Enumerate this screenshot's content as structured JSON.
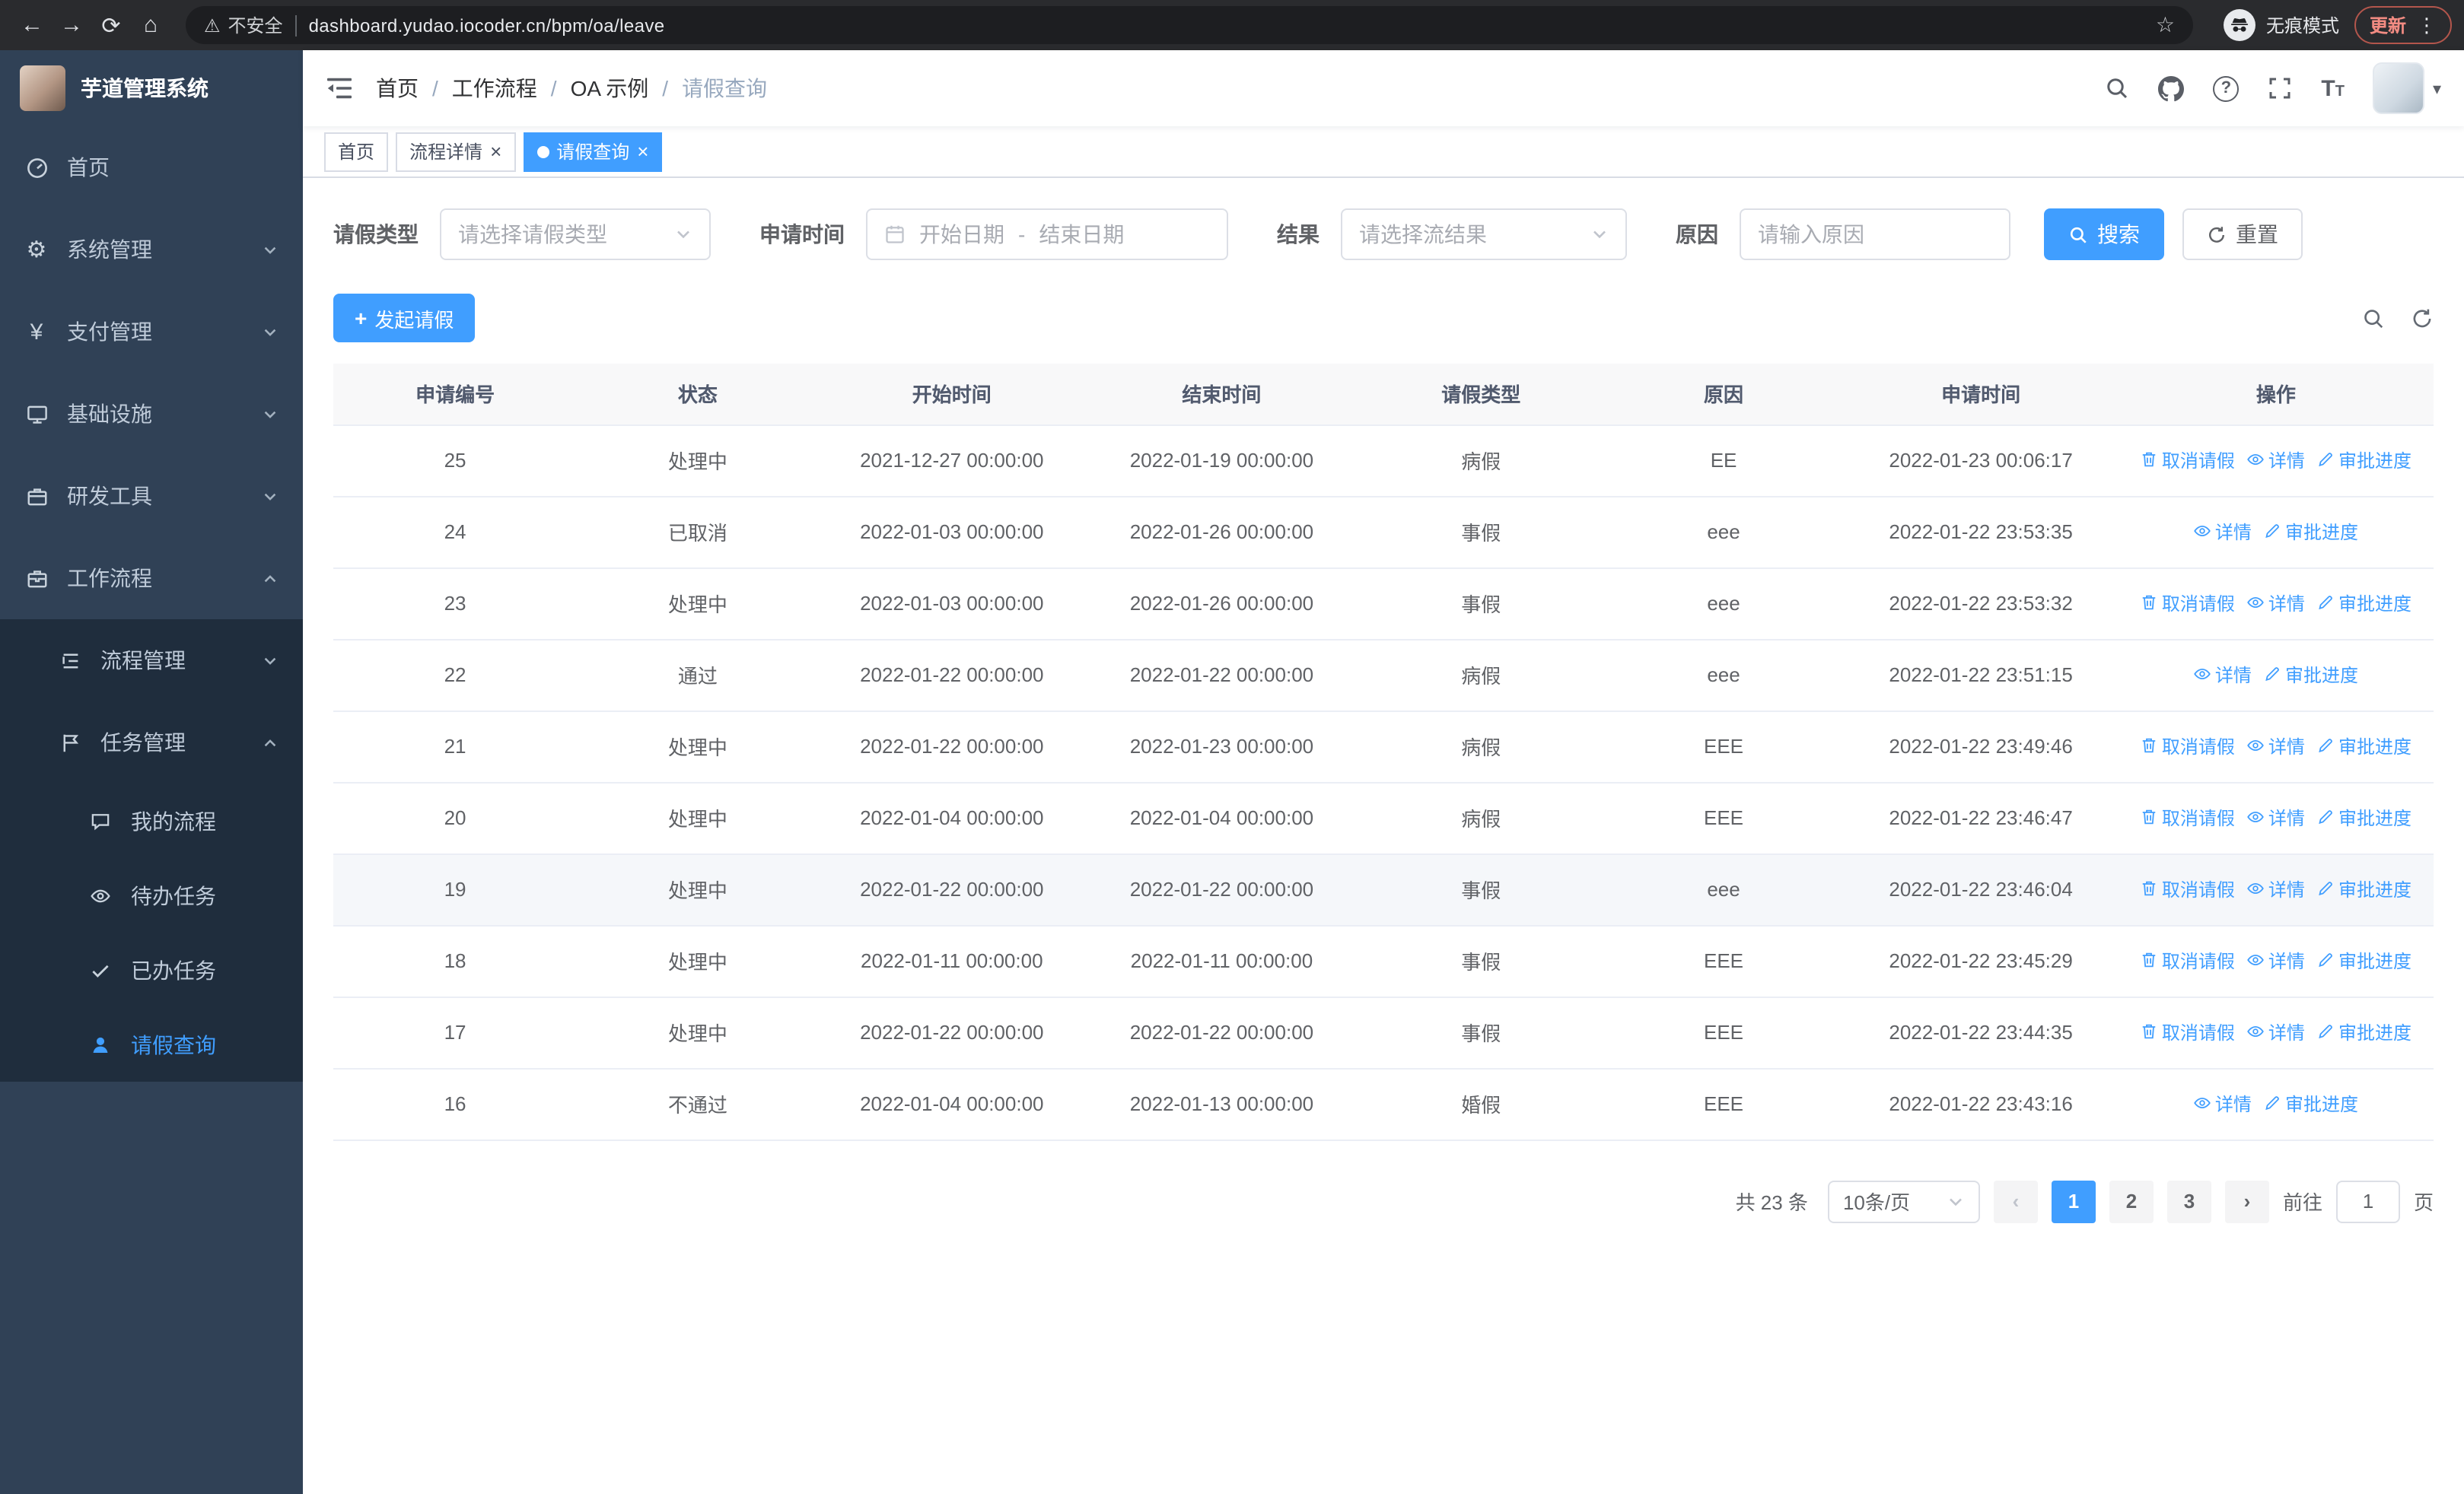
{
  "browser": {
    "security_chip": "不安全",
    "url": "dashboard.yudao.iocoder.cn/bpm/oa/leave",
    "incognito_label": "无痕模式",
    "update_label": "更新"
  },
  "icons": {
    "back": "←",
    "forward": "→",
    "reload": "⟳",
    "home": "⌂",
    "warning": "⚠",
    "star": "☆",
    "menu_dots": "⋮",
    "gear": "⚙",
    "yen": "¥",
    "caret_down": "▾",
    "close": "×",
    "plus": "+",
    "prev": "‹",
    "next": "›",
    "question": "?"
  },
  "sidebar": {
    "app_title": "芋道管理系统",
    "items": [
      {
        "label": "首页"
      },
      {
        "label": "系统管理"
      },
      {
        "label": "支付管理"
      },
      {
        "label": "基础设施"
      },
      {
        "label": "研发工具"
      },
      {
        "label": "工作流程"
      }
    ],
    "submenu": [
      {
        "label": "流程管理"
      },
      {
        "label": "任务管理"
      }
    ],
    "task_children": [
      {
        "label": "我的流程"
      },
      {
        "label": "待办任务"
      },
      {
        "label": "已办任务"
      },
      {
        "label": "请假查询"
      }
    ]
  },
  "header": {
    "breadcrumb": [
      "首页",
      "工作流程",
      "OA 示例",
      "请假查询"
    ]
  },
  "tabs": [
    {
      "label": "首页"
    },
    {
      "label": "流程详情"
    },
    {
      "label": "请假查询"
    }
  ],
  "filters": {
    "leave_type_label": "请假类型",
    "leave_type_placeholder": "请选择请假类型",
    "apply_time_label": "申请时间",
    "start_date_placeholder": "开始日期",
    "date_separator": "-",
    "end_date_placeholder": "结束日期",
    "result_label": "结果",
    "result_placeholder": "请选择流结果",
    "reason_label": "原因",
    "reason_placeholder": "请输入原因",
    "search_label": "搜索",
    "reset_label": "重置"
  },
  "toolbar": {
    "create_label": "发起请假"
  },
  "table": {
    "columns": [
      "申请编号",
      "状态",
      "开始时间",
      "结束时间",
      "请假类型",
      "原因",
      "申请时间",
      "操作"
    ],
    "action_labels": {
      "cancel": "取消请假",
      "detail": "详情",
      "progress": "审批进度"
    },
    "rows": [
      {
        "id": "25",
        "status": "处理中",
        "start": "2021-12-27 00:00:00",
        "end": "2022-01-19 00:00:00",
        "type": "病假",
        "reason": "EE",
        "applied": "2022-01-23 00:06:17",
        "actions": [
          "cancel",
          "detail",
          "progress"
        ]
      },
      {
        "id": "24",
        "status": "已取消",
        "start": "2022-01-03 00:00:00",
        "end": "2022-01-26 00:00:00",
        "type": "事假",
        "reason": "eee",
        "applied": "2022-01-22 23:53:35",
        "actions": [
          "detail",
          "progress"
        ]
      },
      {
        "id": "23",
        "status": "处理中",
        "start": "2022-01-03 00:00:00",
        "end": "2022-01-26 00:00:00",
        "type": "事假",
        "reason": "eee",
        "applied": "2022-01-22 23:53:32",
        "actions": [
          "cancel",
          "detail",
          "progress"
        ]
      },
      {
        "id": "22",
        "status": "通过",
        "start": "2022-01-22 00:00:00",
        "end": "2022-01-22 00:00:00",
        "type": "病假",
        "reason": "eee",
        "applied": "2022-01-22 23:51:15",
        "actions": [
          "detail",
          "progress"
        ]
      },
      {
        "id": "21",
        "status": "处理中",
        "start": "2022-01-22 00:00:00",
        "end": "2022-01-23 00:00:00",
        "type": "病假",
        "reason": "EEE",
        "applied": "2022-01-22 23:49:46",
        "actions": [
          "cancel",
          "detail",
          "progress"
        ]
      },
      {
        "id": "20",
        "status": "处理中",
        "start": "2022-01-04 00:00:00",
        "end": "2022-01-04 00:00:00",
        "type": "病假",
        "reason": "EEE",
        "applied": "2022-01-22 23:46:47",
        "actions": [
          "cancel",
          "detail",
          "progress"
        ]
      },
      {
        "id": "19",
        "status": "处理中",
        "start": "2022-01-22 00:00:00",
        "end": "2022-01-22 00:00:00",
        "type": "事假",
        "reason": "eee",
        "applied": "2022-01-22 23:46:04",
        "actions": [
          "cancel",
          "detail",
          "progress"
        ],
        "highlighted": true
      },
      {
        "id": "18",
        "status": "处理中",
        "start": "2022-01-11 00:00:00",
        "end": "2022-01-11 00:00:00",
        "type": "事假",
        "reason": "EEE",
        "applied": "2022-01-22 23:45:29",
        "actions": [
          "cancel",
          "detail",
          "progress"
        ]
      },
      {
        "id": "17",
        "status": "处理中",
        "start": "2022-01-22 00:00:00",
        "end": "2022-01-22 00:00:00",
        "type": "事假",
        "reason": "EEE",
        "applied": "2022-01-22 23:44:35",
        "actions": [
          "cancel",
          "detail",
          "progress"
        ]
      },
      {
        "id": "16",
        "status": "不通过",
        "start": "2022-01-04 00:00:00",
        "end": "2022-01-13 00:00:00",
        "type": "婚假",
        "reason": "EEE",
        "applied": "2022-01-22 23:43:16",
        "actions": [
          "detail",
          "progress"
        ]
      }
    ]
  },
  "pagination": {
    "total": "共 23 条",
    "page_size": "10条/页",
    "pages": [
      "1",
      "2",
      "3"
    ],
    "active_page": "1",
    "goto_label": "前往",
    "goto_value": "1",
    "page_suffix": "页"
  },
  "colors": {
    "primary": "#409eff",
    "sidebar_bg": "#304156",
    "submenu_bg": "#1f2d3d",
    "active_tab_bg": "#409eff",
    "update_badge": "#f28b82"
  }
}
